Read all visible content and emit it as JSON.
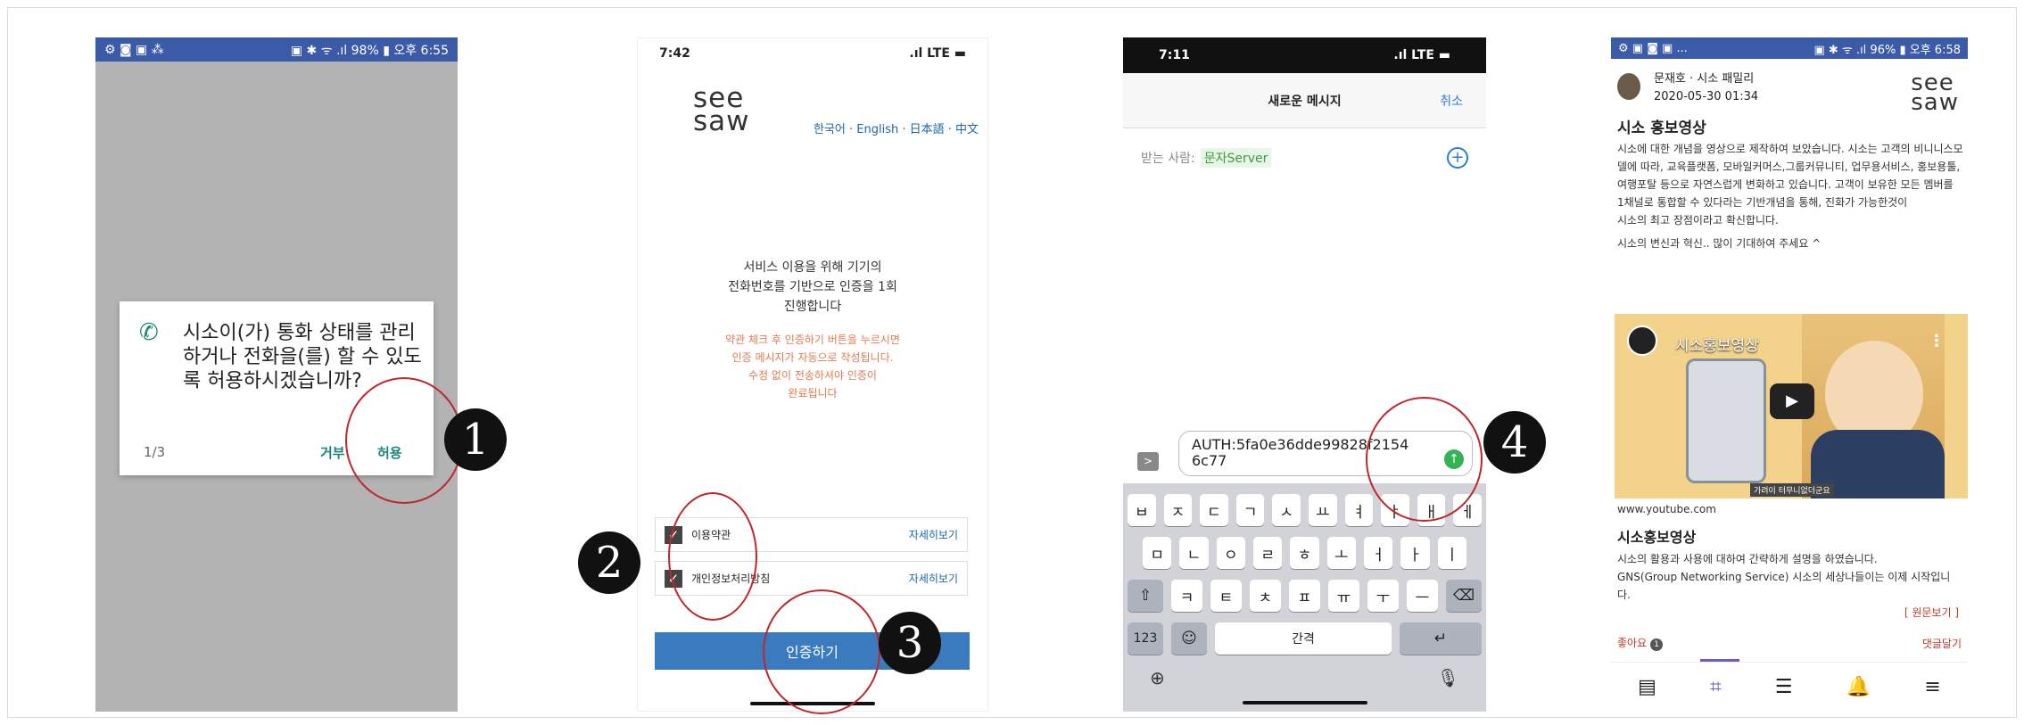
{
  "steps": [
    "1",
    "2",
    "3",
    "4"
  ],
  "phone1": {
    "status_left": "⚙ ◙ ▣ ⁂",
    "status_right": "▣ ✱ ᯤ .ıl 98% ▮ 오후 6:55",
    "dialog_text": "시소이(가) 통화 상태를 관리하거나 전화을(를) 할 수 있도록 허용하시겠습니까?",
    "page": "1/3",
    "deny": "거부",
    "allow": "허용"
  },
  "phone2": {
    "time": "7:42",
    "signal": ".ıl LTE ▬",
    "logo_top": "see",
    "logo_bottom": "saw",
    "languages": "한국어 · English · 日本語 · 中文",
    "info_main": "서비스 이용을 위해 기기의\n전화번호를 기반으로 인증을 1회\n진행합니다",
    "info_warn": "약관 체크 후 인증하기 버튼을 누르시면\n인증 메시지가 자동으로 작성됩니다.\n수정 없이 전송하셔야 인증이\n완료됩니다",
    "check1": "이용약관",
    "check2": "개인정보처리방침",
    "more": "자세히보기",
    "auth_button": "인증하기"
  },
  "phone3": {
    "time": "7:11",
    "signal": ".ıl LTE ▬",
    "title": "새로운 메시지",
    "cancel": "취소",
    "to_label": "받는 사람:",
    "to_value": "문자Server",
    "message": "AUTH:5fa0e36dde99828f2154 6c77",
    "keyboard": {
      "row1": [
        "ㅂ",
        "ㅈ",
        "ㄷ",
        "ㄱ",
        "ㅅ",
        "ㅛ",
        "ㅕ",
        "ㅑ",
        "ㅐ",
        "ㅔ"
      ],
      "row2": [
        "ㅁ",
        "ㄴ",
        "ㅇ",
        "ㄹ",
        "ㅎ",
        "ㅗ",
        "ㅓ",
        "ㅏ",
        "ㅣ"
      ],
      "row3": [
        "ㅋ",
        "ㅌ",
        "ㅊ",
        "ㅍ",
        "ㅠ",
        "ㅜ",
        "ㅡ"
      ],
      "numbers": "123",
      "space": "간격"
    }
  },
  "phone4": {
    "status_left": "⚙ ▣ ◙ ▣ ...",
    "status_right": "▣ ✱ ᯤ .ıl 96% ▮ 오후 6:58",
    "author": "문재호 · 시소 패밀리",
    "date": "2020-05-30 01:34",
    "logo_top": "see",
    "logo_bottom": "saw",
    "post_title": "시소 홍보영상",
    "post_body": "시소에 대한 개념을 영상으로 제작하여 보았습니다. 시소는 고객의 비니니스모델에 따라, 교육플랫폼, 모바일커머스,그룹커뮤니티, 업무용서비스, 홍보용툴,여행포탈 등으로 자연스럽게 변화하고 있습니다. 고객이 보유한 모든 멤버를 1채널로 통합할 수 있다라는 기반개념을 통해, 진화가 가능한것이\n시소의 최고 장점이라고 확신합니다.",
    "post_body2": "시소의 변신과 혁신.. 많이 기대하여 주세요 ^",
    "video_title": "시소홍보영상",
    "video_caption": "가려이 터무니없더군요",
    "link": "www.youtube.com",
    "link_title": "시소홍보영상",
    "link_body": "시소의 활용과 사용에 대하여 간략하게 설명을 하였습니다.\nGNS(Group Networking Service) 시소의 세상나들이는 이제 시작입니다.",
    "original": "[ 원문보기 ]",
    "likes": "좋아요",
    "like_count": "1",
    "comment": "댓글달기"
  }
}
